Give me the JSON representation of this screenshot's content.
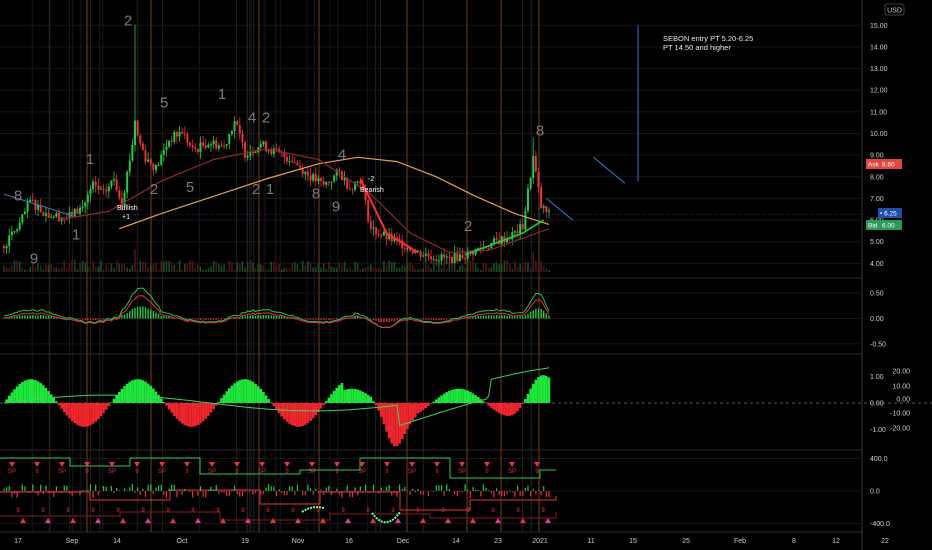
{
  "currency": "USD",
  "chart_data": [
    {
      "type": "candlestick",
      "panel": "price",
      "ylim": [
        3.6,
        15.8
      ],
      "y_ticks": [
        "15.00",
        "14.00",
        "13.00",
        "12.00",
        "11.00",
        "10.00",
        "9.00",
        "8.00",
        "7.00",
        "6.00",
        "5.00",
        "4.00"
      ],
      "x_ticks": [
        "17",
        "Sep",
        "14",
        "Oct",
        "19",
        "Nov",
        "16",
        "Dec",
        "14",
        "23",
        "2021",
        "11",
        "15",
        "25",
        "Feb",
        "8",
        "12",
        "22"
      ],
      "price_tags": {
        "ask_label": "Ask",
        "ask_value": "8.60",
        "last_value": "6.25",
        "bid_label": "Bid",
        "bid_value": "6.00"
      },
      "annotation_lines": [
        "SEBON entry PT 5.20-6.25",
        "PT 14.50 and higher"
      ],
      "signal_labels": [
        {
          "text": "Bullish",
          "sub": "+1",
          "color": "#ffffff"
        },
        {
          "text": "Bearish",
          "sub": "-2",
          "color": "#ffffff"
        }
      ],
      "td_counts_top": [
        "8",
        "1",
        "2",
        "5",
        "1",
        "4",
        "2",
        "4",
        "8"
      ],
      "td_counts_bottom": [
        "9",
        "1",
        "2",
        "5",
        "2",
        "1",
        "8",
        "9",
        "2"
      ],
      "close_path": [
        {
          "d": 0,
          "c": 4.8
        },
        {
          "d": 6,
          "c": 5.8
        },
        {
          "d": 10,
          "c": 6.9
        },
        {
          "d": 16,
          "c": 6.3
        },
        {
          "d": 24,
          "c": 6.1
        },
        {
          "d": 30,
          "c": 6.6
        },
        {
          "d": 34,
          "c": 7.6
        },
        {
          "d": 38,
          "c": 7.2
        },
        {
          "d": 42,
          "c": 7.9
        },
        {
          "d": 45,
          "c": 6.8
        },
        {
          "d": 50,
          "c": 10.2
        },
        {
          "d": 54,
          "c": 8.9
        },
        {
          "d": 58,
          "c": 8.4
        },
        {
          "d": 63,
          "c": 9.7
        },
        {
          "d": 68,
          "c": 10.1
        },
        {
          "d": 72,
          "c": 9.2
        },
        {
          "d": 78,
          "c": 9.6
        },
        {
          "d": 84,
          "c": 9.4
        },
        {
          "d": 88,
          "c": 10.6
        },
        {
          "d": 92,
          "c": 9.1
        },
        {
          "d": 98,
          "c": 9.5
        },
        {
          "d": 104,
          "c": 9.1
        },
        {
          "d": 110,
          "c": 8.8
        },
        {
          "d": 116,
          "c": 8.1
        },
        {
          "d": 122,
          "c": 7.6
        },
        {
          "d": 128,
          "c": 8.2
        },
        {
          "d": 132,
          "c": 7.5
        },
        {
          "d": 136,
          "c": 7.9
        },
        {
          "d": 140,
          "c": 5.6
        },
        {
          "d": 146,
          "c": 5.2
        },
        {
          "d": 152,
          "c": 4.9
        },
        {
          "d": 158,
          "c": 4.5
        },
        {
          "d": 164,
          "c": 4.3
        },
        {
          "d": 170,
          "c": 4.2
        },
        {
          "d": 176,
          "c": 4.4
        },
        {
          "d": 182,
          "c": 4.7
        },
        {
          "d": 188,
          "c": 5.0
        },
        {
          "d": 194,
          "c": 5.3
        },
        {
          "d": 198,
          "c": 5.7
        },
        {
          "d": 202,
          "c": 8.9
        },
        {
          "d": 205,
          "c": 6.6
        },
        {
          "d": 208,
          "c": 6.25
        }
      ],
      "orange_ma": [
        {
          "d": 44,
          "v": 5.6
        },
        {
          "d": 60,
          "v": 6.3
        },
        {
          "d": 80,
          "v": 7.1
        },
        {
          "d": 100,
          "v": 7.9
        },
        {
          "d": 120,
          "v": 8.6
        },
        {
          "d": 135,
          "v": 8.9
        },
        {
          "d": 150,
          "v": 8.7
        },
        {
          "d": 165,
          "v": 8.0
        },
        {
          "d": 180,
          "v": 7.1
        },
        {
          "d": 195,
          "v": 6.3
        },
        {
          "d": 208,
          "v": 5.8
        }
      ],
      "dark_ma": [
        {
          "d": 20,
          "v": 6.0
        },
        {
          "d": 40,
          "v": 6.4
        },
        {
          "d": 60,
          "v": 7.8
        },
        {
          "d": 80,
          "v": 8.8
        },
        {
          "d": 100,
          "v": 9.3
        },
        {
          "d": 120,
          "v": 8.8
        },
        {
          "d": 140,
          "v": 7.2
        },
        {
          "d": 155,
          "v": 5.4
        },
        {
          "d": 170,
          "v": 4.5
        },
        {
          "d": 185,
          "v": 4.6
        },
        {
          "d": 208,
          "v": 5.6
        }
      ],
      "trendlines": [
        {
          "x1": 0,
          "y1": 7.2,
          "x2": 26,
          "y2": 6.2
        },
        {
          "x1": 207,
          "y1": 7.0,
          "x2": 217,
          "y2": 6.0
        },
        {
          "x1": 225,
          "y1": 8.9,
          "x2": 237,
          "y2": 7.7
        },
        {
          "x1": 242,
          "y1": 7.8,
          "x2": 242,
          "y2": 15.0
        }
      ]
    },
    {
      "type": "line",
      "panel": "oscillator-1",
      "y_ticks": [
        "0.50",
        "0.00",
        "-0.50"
      ],
      "ylim": [
        -0.62,
        0.72
      ]
    },
    {
      "type": "area",
      "panel": "oscillator-2",
      "y_ticks_left": [
        "1.00",
        "0.00",
        "-1.00"
      ],
      "y_ticks_right": [
        "20.00",
        "10.00",
        "0.00",
        "-10.00",
        "-20.00"
      ],
      "ylim": [
        -1.7,
        1.7
      ]
    },
    {
      "type": "line",
      "panel": "signals",
      "y_ticks": [
        "400.0",
        "0.0",
        "-400.0"
      ],
      "ylim": [
        -480,
        480
      ],
      "marker_text": [
        "SP",
        "9"
      ]
    }
  ]
}
